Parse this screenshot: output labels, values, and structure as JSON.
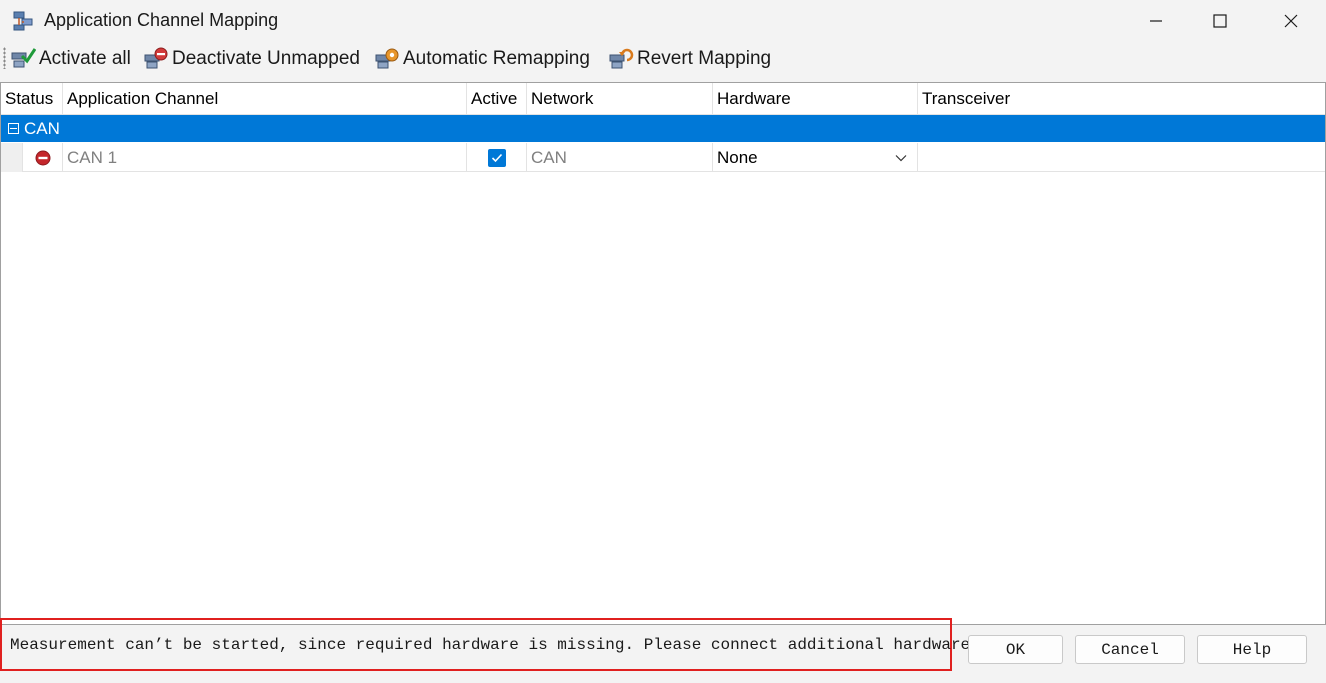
{
  "window": {
    "title": "Application Channel Mapping"
  },
  "toolbar": {
    "activate_all": "Activate all",
    "deactivate_unmapped": "Deactivate Unmapped",
    "automatic_remapping": "Automatic Remapping",
    "revert_mapping": "Revert Mapping"
  },
  "grid": {
    "columns": [
      "Status",
      "Application Channel",
      "Active",
      "Network",
      "Hardware",
      "Transceiver"
    ],
    "group": {
      "label": "CAN"
    },
    "rows": [
      {
        "status_icon": "no-entry-icon",
        "channel": "CAN 1",
        "active": true,
        "network": "CAN",
        "hardware": "None",
        "transceiver": ""
      }
    ]
  },
  "status": {
    "icon": "error-icon",
    "message": "Measurement can’t be started, since required hardware is missing. Please connect additional hardware."
  },
  "buttons": {
    "ok": "OK",
    "cancel": "Cancel",
    "help": "Help"
  },
  "colors": {
    "selection": "#0078d7",
    "error": "#c4262b",
    "highlight_border": "#e0201f"
  }
}
